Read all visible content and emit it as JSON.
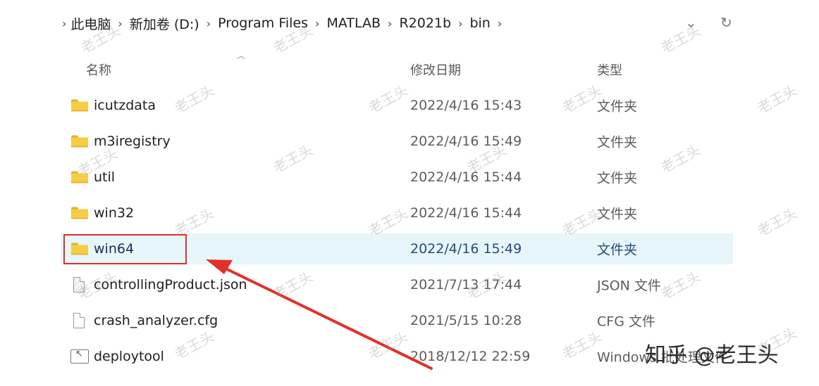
{
  "breadcrumb": [
    "此电脑",
    "新加卷 (D:)",
    "Program Files",
    "MATLAB",
    "R2021b",
    "bin"
  ],
  "columns": {
    "name": "名称",
    "date": "修改日期",
    "type": "类型"
  },
  "rows": [
    {
      "name": "icutzdata",
      "date": "2022/4/16 15:43",
      "type": "文件夹",
      "icon": "folder-icon"
    },
    {
      "name": "m3iregistry",
      "date": "2022/4/16 15:49",
      "type": "文件夹",
      "icon": "folder-icon"
    },
    {
      "name": "util",
      "date": "2022/4/16 15:44",
      "type": "文件夹",
      "icon": "folder-icon"
    },
    {
      "name": "win32",
      "date": "2022/4/16 15:44",
      "type": "文件夹",
      "icon": "folder-icon"
    },
    {
      "name": "win64",
      "date": "2022/4/16 15:49",
      "type": "文件夹",
      "icon": "folder-icon",
      "selected": true
    },
    {
      "name": "controllingProduct.json",
      "date": "2021/7/13 17:44",
      "type": "JSON 文件",
      "icon": "json-file-icon"
    },
    {
      "name": "crash_analyzer.cfg",
      "date": "2021/5/15 10:28",
      "type": "CFG 文件",
      "icon": "file-icon"
    },
    {
      "name": "deploytool",
      "date": "2018/12/12 22:59",
      "type": "Windows 批处理文件",
      "icon": "batch-file-icon"
    }
  ],
  "watermark": "老王头",
  "brand": "知乎 @老王头",
  "colors": {
    "selection": "#e6f6fa",
    "highlight": "#e2302a",
    "folder": "#f6cd45"
  }
}
